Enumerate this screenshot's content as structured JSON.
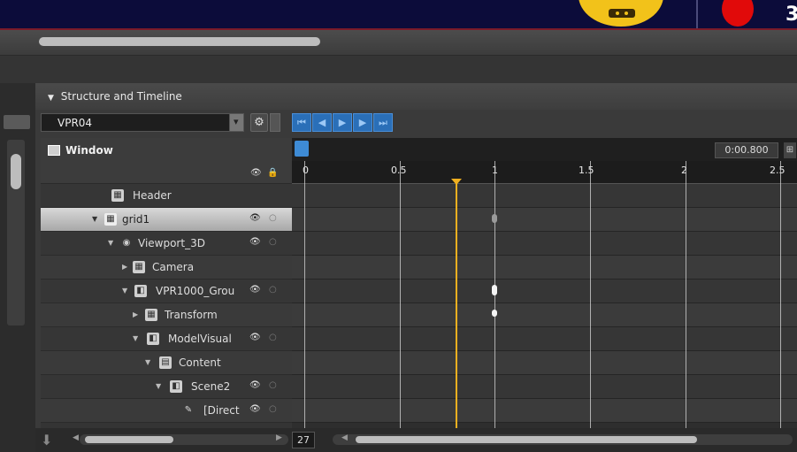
{
  "top_bar": {
    "number": "3"
  },
  "panel": {
    "title": "Structure and Timeline",
    "dropdown_value": "VPR04"
  },
  "tree": {
    "header_label": "Window",
    "items": [
      {
        "label": "Header",
        "icon": "grid-icon"
      },
      {
        "label": "grid1",
        "icon": "grid-icon",
        "selected": true
      },
      {
        "label": "Viewport_3D",
        "icon": "viewport-icon"
      },
      {
        "label": "Camera",
        "icon": "grid-icon"
      },
      {
        "label": "VPR1000_Grou",
        "icon": "group-icon"
      },
      {
        "label": "Transform",
        "icon": "grid-icon"
      },
      {
        "label": "ModelVisual",
        "icon": "group-icon"
      },
      {
        "label": "Content",
        "icon": "content-icon"
      },
      {
        "label": "Scene2",
        "icon": "group-icon"
      },
      {
        "label": "[Direct",
        "icon": "light-icon"
      }
    ]
  },
  "timeline": {
    "current_time": "0:00.800",
    "ticks": [
      "0",
      "0.5",
      "1",
      "1.5",
      "2",
      "2.5"
    ],
    "zoom": "27"
  },
  "colors": {
    "accent_blue": "#2a6fb8",
    "playhead": "#f0b020",
    "record": "#e10a0a"
  }
}
